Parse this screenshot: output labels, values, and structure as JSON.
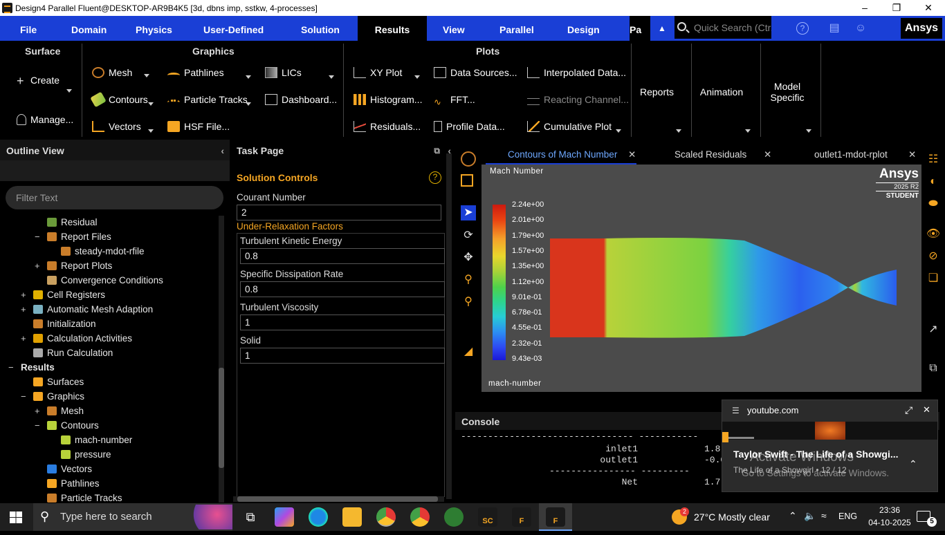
{
  "window": {
    "title": "Design4 Parallel Fluent@DESKTOP-AR9B4K5  [3d, dbns imp, sstkw, 4-processes]"
  },
  "menubar": {
    "items": [
      "File",
      "Domain",
      "Physics",
      "User-Defined",
      "Solution",
      "Results",
      "View",
      "Parallel",
      "Design",
      "Pa"
    ],
    "active": "Results",
    "search_placeholder": "Quick Search (Ctr...",
    "brand": "Ansys"
  },
  "ribbon": {
    "surface": {
      "title": "Surface",
      "create": "Create",
      "manage": "Manage..."
    },
    "graphics": {
      "title": "Graphics",
      "mesh": "Mesh",
      "contours": "Contours",
      "vectors": "Vectors",
      "pathlines": "Pathlines",
      "particle_tracks": "Particle Tracks",
      "hsf": "HSF File...",
      "lics": "LICs",
      "dashboard": "Dashboard..."
    },
    "plots": {
      "title": "Plots",
      "xy": "XY Plot",
      "histogram": "Histogram...",
      "residuals": "Residuals...",
      "data_sources": "Data Sources...",
      "fft": "FFT...",
      "profile": "Profile Data...",
      "interpolated": "Interpolated Data...",
      "reacting": "Reacting Channel...",
      "cumulative": "Cumulative Plot"
    },
    "reports": "Reports",
    "animation": "Animation",
    "model_specific": "Model Specific"
  },
  "outline": {
    "title": "Outline View",
    "filter_placeholder": "Filter Text",
    "items": [
      {
        "label": "Residual",
        "pm": ""
      },
      {
        "label": "Report Files",
        "pm": "−"
      },
      {
        "label": "steady-mdot-rfile",
        "pm": ""
      },
      {
        "label": "Report Plots",
        "pm": "+"
      },
      {
        "label": "Convergence Conditions",
        "pm": ""
      },
      {
        "label": "Cell Registers",
        "pm": "+"
      },
      {
        "label": "Automatic Mesh Adaption",
        "pm": "+"
      },
      {
        "label": "Initialization",
        "pm": ""
      },
      {
        "label": "Calculation Activities",
        "pm": "+"
      },
      {
        "label": "Run Calculation",
        "pm": ""
      },
      {
        "label": "Results",
        "pm": "−"
      },
      {
        "label": "Surfaces",
        "pm": ""
      },
      {
        "label": "Graphics",
        "pm": "−"
      },
      {
        "label": "Mesh",
        "pm": "+"
      },
      {
        "label": "Contours",
        "pm": "−"
      },
      {
        "label": "mach-number",
        "pm": ""
      },
      {
        "label": "pressure",
        "pm": ""
      },
      {
        "label": "Vectors",
        "pm": ""
      },
      {
        "label": "Pathlines",
        "pm": ""
      },
      {
        "label": "Particle Tracks",
        "pm": ""
      }
    ]
  },
  "taskpage": {
    "title": "Task Page",
    "heading": "Solution Controls",
    "courant_label": "Courant Number",
    "courant_value": "2",
    "urf_heading": "Under-Relaxation Factors",
    "fields": [
      {
        "label": "Turbulent Kinetic Energy",
        "value": "0.8"
      },
      {
        "label": "Specific Dissipation Rate",
        "value": "0.8"
      },
      {
        "label": "Turbulent Viscosity",
        "value": "1"
      },
      {
        "label": "Solid",
        "value": "1"
      }
    ]
  },
  "graphics": {
    "tabs": [
      "Contours of Mach Number",
      "Scaled Residuals",
      "outlet1-mdot-rplot"
    ],
    "active_tab": "Contours of Mach Number",
    "plot_title": "Mach Number",
    "footer_label": "mach-number",
    "logo": {
      "brand": "Ansys",
      "version": "2025 R2",
      "edition": "STUDENT"
    },
    "colorbar_labels": [
      "2.24e+00",
      "2.01e+00",
      "1.79e+00",
      "1.57e+00",
      "1.35e+00",
      "1.12e+00",
      "9.01e-01",
      "6.78e-01",
      "4.55e-01",
      "2.32e-01",
      "9.43e-03"
    ]
  },
  "console": {
    "title": "Console",
    "rows": [
      {
        "name": "inlet1",
        "value": "1.8"
      },
      {
        "name": "outlet1",
        "value": "-0.0"
      },
      {
        "name": "Net",
        "value": "1.7"
      }
    ]
  },
  "popup": {
    "site": "youtube.com",
    "title": "Taylor Swift - The Life of a Showgi...",
    "subtitle": "The Life of a Showgirl • 12 / 12",
    "watermark1": "Activate Windows",
    "watermark2": "Go to Settings to activate Windows."
  },
  "taskbar": {
    "search_placeholder": "Type here to search",
    "weather": "27°C  Mostly clear",
    "weather_badge": "2",
    "lang": "ENG",
    "time": "23:36",
    "date": "04-10-2025",
    "notif_count": "5"
  }
}
